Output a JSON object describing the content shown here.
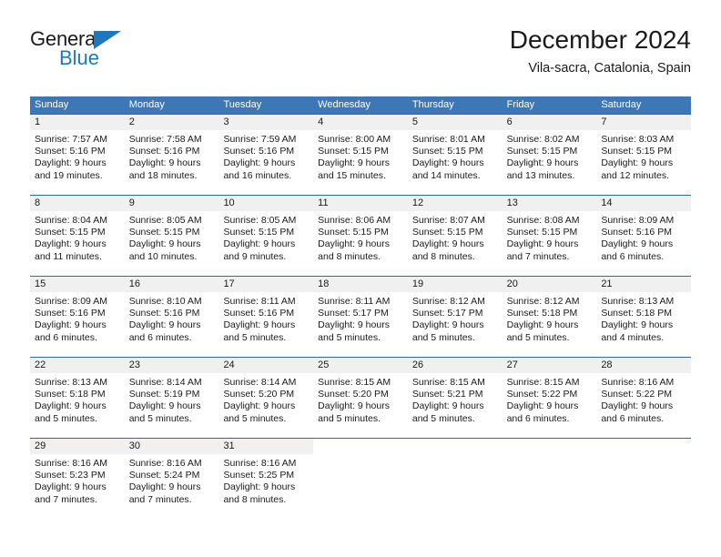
{
  "brand": {
    "name_top": "General",
    "name_bottom": "Blue",
    "accent_color": "#1f77be"
  },
  "header": {
    "title": "December 2024",
    "subtitle": "Vila-sacra, Catalonia, Spain"
  },
  "theme": {
    "header_row_bg": "#3b78b5",
    "row_divider": "#2c6da8",
    "day_number_band_bg": "#f0f0f0",
    "text_color": "#1a1a1a"
  },
  "weekday_headers": [
    "Sunday",
    "Monday",
    "Tuesday",
    "Wednesday",
    "Thursday",
    "Friday",
    "Saturday"
  ],
  "weeks": [
    [
      {
        "day": "1",
        "sunrise": "Sunrise: 7:57 AM",
        "sunset": "Sunset: 5:16 PM",
        "daylight_1": "Daylight: 9 hours",
        "daylight_2": "and 19 minutes."
      },
      {
        "day": "2",
        "sunrise": "Sunrise: 7:58 AM",
        "sunset": "Sunset: 5:16 PM",
        "daylight_1": "Daylight: 9 hours",
        "daylight_2": "and 18 minutes."
      },
      {
        "day": "3",
        "sunrise": "Sunrise: 7:59 AM",
        "sunset": "Sunset: 5:16 PM",
        "daylight_1": "Daylight: 9 hours",
        "daylight_2": "and 16 minutes."
      },
      {
        "day": "4",
        "sunrise": "Sunrise: 8:00 AM",
        "sunset": "Sunset: 5:15 PM",
        "daylight_1": "Daylight: 9 hours",
        "daylight_2": "and 15 minutes."
      },
      {
        "day": "5",
        "sunrise": "Sunrise: 8:01 AM",
        "sunset": "Sunset: 5:15 PM",
        "daylight_1": "Daylight: 9 hours",
        "daylight_2": "and 14 minutes."
      },
      {
        "day": "6",
        "sunrise": "Sunrise: 8:02 AM",
        "sunset": "Sunset: 5:15 PM",
        "daylight_1": "Daylight: 9 hours",
        "daylight_2": "and 13 minutes."
      },
      {
        "day": "7",
        "sunrise": "Sunrise: 8:03 AM",
        "sunset": "Sunset: 5:15 PM",
        "daylight_1": "Daylight: 9 hours",
        "daylight_2": "and 12 minutes."
      }
    ],
    [
      {
        "day": "8",
        "sunrise": "Sunrise: 8:04 AM",
        "sunset": "Sunset: 5:15 PM",
        "daylight_1": "Daylight: 9 hours",
        "daylight_2": "and 11 minutes."
      },
      {
        "day": "9",
        "sunrise": "Sunrise: 8:05 AM",
        "sunset": "Sunset: 5:15 PM",
        "daylight_1": "Daylight: 9 hours",
        "daylight_2": "and 10 minutes."
      },
      {
        "day": "10",
        "sunrise": "Sunrise: 8:05 AM",
        "sunset": "Sunset: 5:15 PM",
        "daylight_1": "Daylight: 9 hours",
        "daylight_2": "and 9 minutes."
      },
      {
        "day": "11",
        "sunrise": "Sunrise: 8:06 AM",
        "sunset": "Sunset: 5:15 PM",
        "daylight_1": "Daylight: 9 hours",
        "daylight_2": "and 8 minutes."
      },
      {
        "day": "12",
        "sunrise": "Sunrise: 8:07 AM",
        "sunset": "Sunset: 5:15 PM",
        "daylight_1": "Daylight: 9 hours",
        "daylight_2": "and 8 minutes."
      },
      {
        "day": "13",
        "sunrise": "Sunrise: 8:08 AM",
        "sunset": "Sunset: 5:15 PM",
        "daylight_1": "Daylight: 9 hours",
        "daylight_2": "and 7 minutes."
      },
      {
        "day": "14",
        "sunrise": "Sunrise: 8:09 AM",
        "sunset": "Sunset: 5:16 PM",
        "daylight_1": "Daylight: 9 hours",
        "daylight_2": "and 6 minutes."
      }
    ],
    [
      {
        "day": "15",
        "sunrise": "Sunrise: 8:09 AM",
        "sunset": "Sunset: 5:16 PM",
        "daylight_1": "Daylight: 9 hours",
        "daylight_2": "and 6 minutes."
      },
      {
        "day": "16",
        "sunrise": "Sunrise: 8:10 AM",
        "sunset": "Sunset: 5:16 PM",
        "daylight_1": "Daylight: 9 hours",
        "daylight_2": "and 6 minutes."
      },
      {
        "day": "17",
        "sunrise": "Sunrise: 8:11 AM",
        "sunset": "Sunset: 5:16 PM",
        "daylight_1": "Daylight: 9 hours",
        "daylight_2": "and 5 minutes."
      },
      {
        "day": "18",
        "sunrise": "Sunrise: 8:11 AM",
        "sunset": "Sunset: 5:17 PM",
        "daylight_1": "Daylight: 9 hours",
        "daylight_2": "and 5 minutes."
      },
      {
        "day": "19",
        "sunrise": "Sunrise: 8:12 AM",
        "sunset": "Sunset: 5:17 PM",
        "daylight_1": "Daylight: 9 hours",
        "daylight_2": "and 5 minutes."
      },
      {
        "day": "20",
        "sunrise": "Sunrise: 8:12 AM",
        "sunset": "Sunset: 5:18 PM",
        "daylight_1": "Daylight: 9 hours",
        "daylight_2": "and 5 minutes."
      },
      {
        "day": "21",
        "sunrise": "Sunrise: 8:13 AM",
        "sunset": "Sunset: 5:18 PM",
        "daylight_1": "Daylight: 9 hours",
        "daylight_2": "and 4 minutes."
      }
    ],
    [
      {
        "day": "22",
        "sunrise": "Sunrise: 8:13 AM",
        "sunset": "Sunset: 5:18 PM",
        "daylight_1": "Daylight: 9 hours",
        "daylight_2": "and 5 minutes."
      },
      {
        "day": "23",
        "sunrise": "Sunrise: 8:14 AM",
        "sunset": "Sunset: 5:19 PM",
        "daylight_1": "Daylight: 9 hours",
        "daylight_2": "and 5 minutes."
      },
      {
        "day": "24",
        "sunrise": "Sunrise: 8:14 AM",
        "sunset": "Sunset: 5:20 PM",
        "daylight_1": "Daylight: 9 hours",
        "daylight_2": "and 5 minutes."
      },
      {
        "day": "25",
        "sunrise": "Sunrise: 8:15 AM",
        "sunset": "Sunset: 5:20 PM",
        "daylight_1": "Daylight: 9 hours",
        "daylight_2": "and 5 minutes."
      },
      {
        "day": "26",
        "sunrise": "Sunrise: 8:15 AM",
        "sunset": "Sunset: 5:21 PM",
        "daylight_1": "Daylight: 9 hours",
        "daylight_2": "and 5 minutes."
      },
      {
        "day": "27",
        "sunrise": "Sunrise: 8:15 AM",
        "sunset": "Sunset: 5:22 PM",
        "daylight_1": "Daylight: 9 hours",
        "daylight_2": "and 6 minutes."
      },
      {
        "day": "28",
        "sunrise": "Sunrise: 8:16 AM",
        "sunset": "Sunset: 5:22 PM",
        "daylight_1": "Daylight: 9 hours",
        "daylight_2": "and 6 minutes."
      }
    ],
    [
      {
        "day": "29",
        "sunrise": "Sunrise: 8:16 AM",
        "sunset": "Sunset: 5:23 PM",
        "daylight_1": "Daylight: 9 hours",
        "daylight_2": "and 7 minutes."
      },
      {
        "day": "30",
        "sunrise": "Sunrise: 8:16 AM",
        "sunset": "Sunset: 5:24 PM",
        "daylight_1": "Daylight: 9 hours",
        "daylight_2": "and 7 minutes."
      },
      {
        "day": "31",
        "sunrise": "Sunrise: 8:16 AM",
        "sunset": "Sunset: 5:25 PM",
        "daylight_1": "Daylight: 9 hours",
        "daylight_2": "and 8 minutes."
      },
      {
        "day": "",
        "sunrise": "",
        "sunset": "",
        "daylight_1": "",
        "daylight_2": ""
      },
      {
        "day": "",
        "sunrise": "",
        "sunset": "",
        "daylight_1": "",
        "daylight_2": ""
      },
      {
        "day": "",
        "sunrise": "",
        "sunset": "",
        "daylight_1": "",
        "daylight_2": ""
      },
      {
        "day": "",
        "sunrise": "",
        "sunset": "",
        "daylight_1": "",
        "daylight_2": ""
      }
    ]
  ]
}
